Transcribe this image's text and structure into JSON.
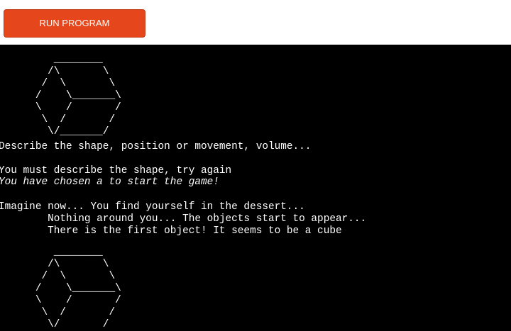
{
  "toolbar": {
    "run_label": "RUN PROGRAM",
    "accent_color": "#e5461b"
  },
  "terminal": {
    "background": "#000000",
    "foreground": "#ffffff",
    "lines": [
      {
        "text": "         ________",
        "italic": false
      },
      {
        "text": "        /\\       \\",
        "italic": false
      },
      {
        "text": "       /  \\       \\",
        "italic": false
      },
      {
        "text": "      /    \\_______\\",
        "italic": false
      },
      {
        "text": "      \\    /       /",
        "italic": false
      },
      {
        "text": "       \\  /       /",
        "italic": false
      },
      {
        "text": "        \\/_______/",
        "italic": false
      },
      {
        "text": "Describe the shape, position or movement, volume...",
        "italic": false
      },
      {
        "text": "",
        "italic": false
      },
      {
        "text": "You must describe the shape, try again",
        "italic": false
      },
      {
        "text": "You have chosen a to start the game!",
        "italic": true
      },
      {
        "text": "",
        "italic": false
      },
      {
        "text": "Imagine now... You find yourself in the dessert...",
        "italic": false
      },
      {
        "text": "        Nothing around you... The objects start to appear...",
        "italic": false
      },
      {
        "text": "        There is the first object! It seems to be a cube",
        "italic": false
      },
      {
        "text": "",
        "italic": false
      },
      {
        "text": "",
        "italic": false
      },
      {
        "text": "         ________",
        "italic": false
      },
      {
        "text": "        /\\       \\",
        "italic": false
      },
      {
        "text": "       /  \\       \\",
        "italic": false
      },
      {
        "text": "      /    \\_______\\",
        "italic": false
      },
      {
        "text": "      \\    /       /",
        "italic": false
      },
      {
        "text": "       \\  /       /",
        "italic": false
      },
      {
        "text": "        \\/       /",
        "italic": false
      }
    ]
  }
}
